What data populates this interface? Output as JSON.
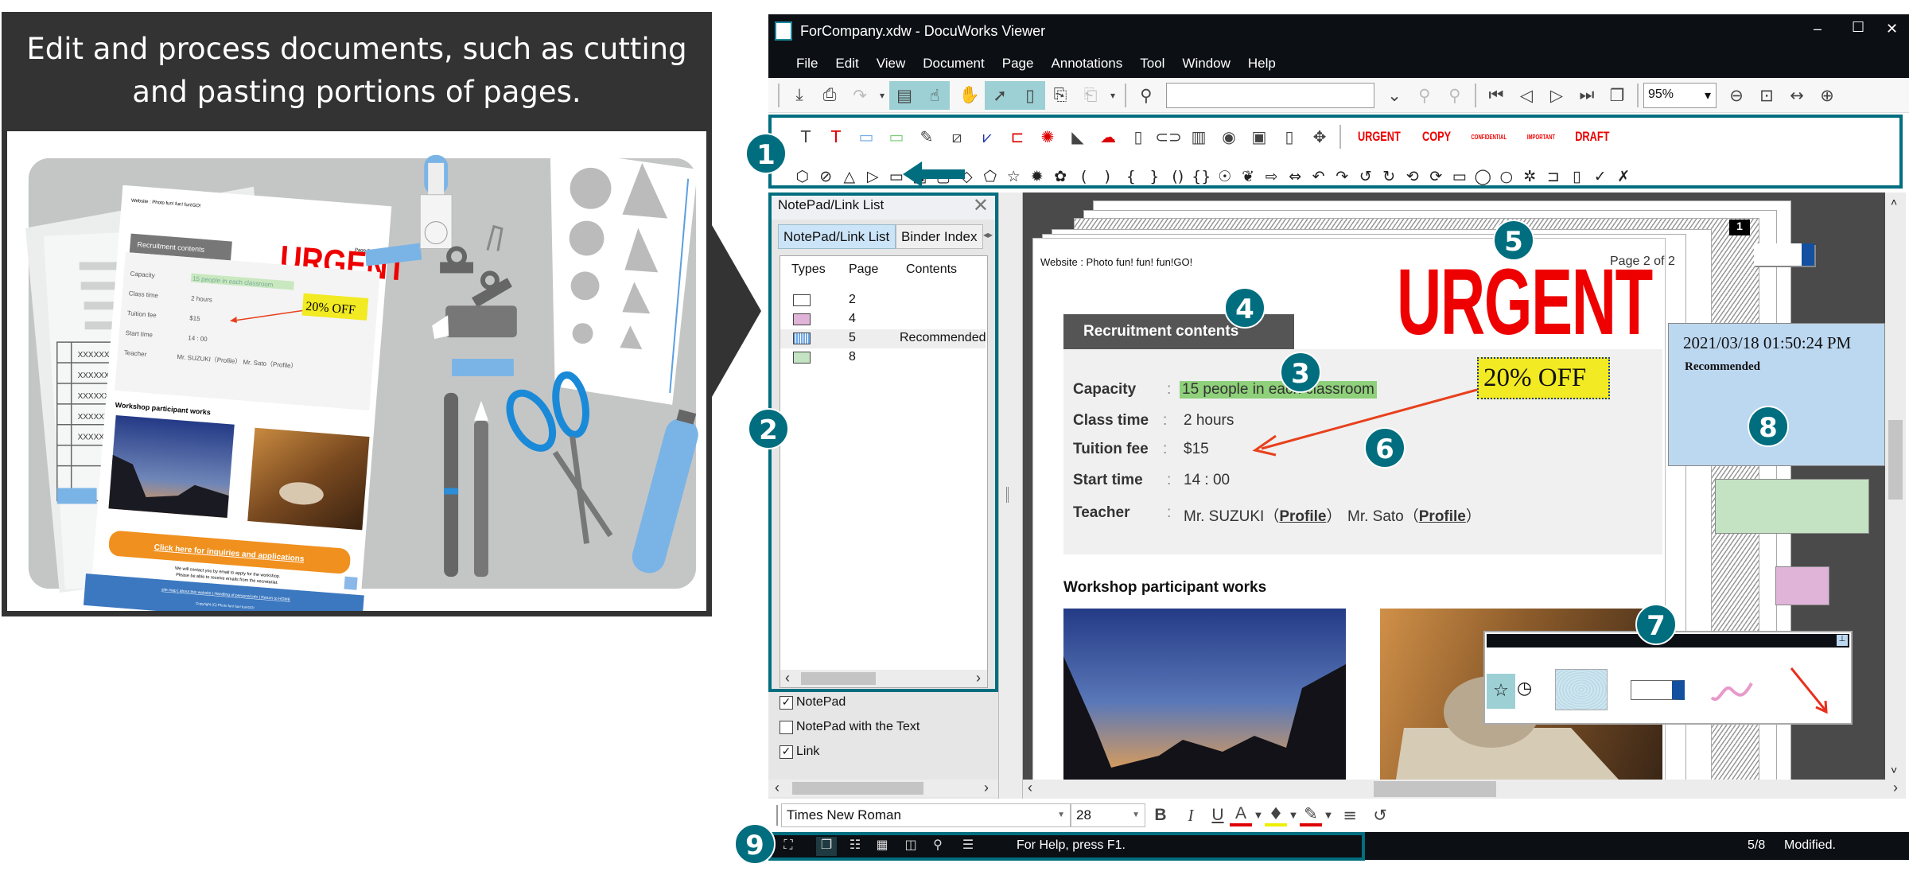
{
  "callout": {
    "title_line1": "Edit and process documents, such as cutting",
    "title_line2": "and pasting portions of pages."
  },
  "illustration": {
    "website": "Website : Photo fun! fun! fun!GO!",
    "page": "Page 2 of 2",
    "stamp": "URGENT",
    "header": "Recruitment contents",
    "rows": [
      {
        "label": "Capacity",
        "value": "15 people in each classroom"
      },
      {
        "label": "Class time",
        "value": "2 hours"
      },
      {
        "label": "Tuition fee",
        "value": "$15"
      },
      {
        "label": "Start time",
        "value": "14 : 00"
      },
      {
        "label": "Teacher",
        "value": "Mr. SUZUKI（Profile）   Mr. Sato（Profile）"
      }
    ],
    "off": "20% OFF",
    "works": "Workshop participant works",
    "cta": "Click here for inquiries and applications",
    "contact1": "We will contact you by email to apply for the workshop.",
    "contact2": "Please be able to receive emails from the secretariat.",
    "footer_links": "site map  |  about this website  |  Handling of personal info  |  Return to HOME",
    "copyright": "Copyright (C) Photo fun! fun! fun!GO!",
    "table_cell": "XXXXXXX"
  },
  "window": {
    "title": "ForCompany.xdw - DocuWorks Viewer",
    "controls": {
      "minimize": "–",
      "maximize": "☐",
      "close": "✕"
    }
  },
  "menu": [
    "File",
    "Edit",
    "View",
    "Document",
    "Page",
    "Annotations",
    "Tool",
    "Window",
    "Help"
  ],
  "toolbar": {
    "icons": [
      "import",
      "print",
      "rotate-90",
      "dropdown",
      "page-view",
      "annotation-hand",
      "separator-none",
      "hand",
      "select-arrow",
      "page-fit",
      "page-insert",
      "page-copy",
      "dropdown",
      "separator",
      "search",
      "SEARCH_INPUT",
      "chevron-down",
      "find-prev",
      "find-next",
      "separator",
      "first-page",
      "prev-page",
      "next-page",
      "last-page",
      "page-stack",
      "separator",
      "ZOOM_SELECT",
      "zoom-out",
      "fit-page",
      "fit-width",
      "zoom-in"
    ],
    "active": [
      "page-view",
      "annotation-hand",
      "select-arrow",
      "page-fit"
    ],
    "disabled": [
      "rotate-90",
      "page-copy",
      "find-prev",
      "find-next"
    ],
    "search_value": "",
    "zoom": "95%"
  },
  "annotation_toolbar": {
    "row1": [
      "text",
      "text-red",
      "marker-blue",
      "marker-green",
      "highlighter",
      "line-box",
      "polyline",
      "rect-dim",
      "circle-dim",
      "fill-shape",
      "cloud",
      "ole",
      "link",
      "barcode",
      "seal",
      "sticker",
      "a4-frame",
      "move"
    ],
    "stamps": [
      "URGENT",
      "COPY",
      "CONFIDENTIAL",
      "IMPORTANT",
      "DRAFT"
    ],
    "row2": [
      "octagon",
      "prohibit",
      "triangle",
      "play",
      "rect-callout",
      "rect-photo",
      "rounded-rect",
      "diamond",
      "tag",
      "star",
      "burst",
      "flower",
      "paren-left",
      "paren-right",
      "brace-left",
      "brace-right",
      "double-paren",
      "double-brace",
      "blob",
      "leaf",
      "arrow-right",
      "arrow-both",
      "u-turn-left",
      "u-turn-right",
      "curl-left",
      "curl-right",
      "loop-left",
      "loop-right",
      "speech-rect",
      "speech-round",
      "speech-oval",
      "speech-cloud",
      "speech-tab",
      "page-fold",
      "check",
      "cross"
    ]
  },
  "sidebar": {
    "title": "NotePad/Link List",
    "tabs": [
      "NotePad/Link List",
      "Binder Index"
    ],
    "columns": [
      "Types",
      "Page",
      "Contents"
    ],
    "rows": [
      {
        "color": "#ffffff",
        "page": "2",
        "contents": ""
      },
      {
        "color": "#e0b4d8",
        "page": "4",
        "contents": ""
      },
      {
        "color": "#6fa8e8",
        "page": "5",
        "contents": "Recommended"
      },
      {
        "color": "#c3e3c3",
        "page": "8",
        "contents": ""
      }
    ],
    "selected_row": 2,
    "checkboxes": [
      {
        "label": "NotePad",
        "checked": true
      },
      {
        "label": "NotePad with the Text",
        "checked": false
      },
      {
        "label": "Link",
        "checked": true
      }
    ]
  },
  "document": {
    "website": "Website : Photo fun! fun! fun!GO!",
    "page_label": "Page 2 of 2",
    "stamp": "URGENT",
    "header": "Recruitment contents",
    "rows": [
      {
        "label": "Capacity",
        "colon": ":",
        "value": "15 people in each classroom"
      },
      {
        "label": "Class time",
        "colon": ":",
        "value": "2 hours"
      },
      {
        "label": "Tuition fee",
        "colon": ":",
        "value": "$15"
      },
      {
        "label": "Start time",
        "colon": ":",
        "value": "14 : 00"
      },
      {
        "label": "Teacher",
        "colon": ":",
        "value": ""
      }
    ],
    "teacher1": "Mr. SUZUKI（",
    "teacher2": "Mr. Sato（",
    "profile": "Profile",
    "close_paren": "）",
    "off": "20% OFF",
    "works_title": "Workshop participant works",
    "stack_number": "1"
  },
  "sticky_note": {
    "datetime": "2021/03/18 01:50:24 PM",
    "text": "Recommended"
  },
  "format_bar": {
    "font": "Times New Roman",
    "size": "28",
    "buttons": [
      "B",
      "I",
      "U",
      "A"
    ]
  },
  "status": {
    "help": "For Help, press F1.",
    "page": "5/8",
    "state": "Modified."
  },
  "badges": [
    "1",
    "2",
    "3",
    "4",
    "5",
    "6",
    "7",
    "8",
    "9"
  ],
  "colors": {
    "accent_teal": "#006e7f",
    "titlebar": "#0c0f14",
    "stamp_red": "#e00000",
    "note_blue": "#bcd7f0",
    "highlight_green": "#8fd07a",
    "off_yellow": "#f2ea22"
  }
}
